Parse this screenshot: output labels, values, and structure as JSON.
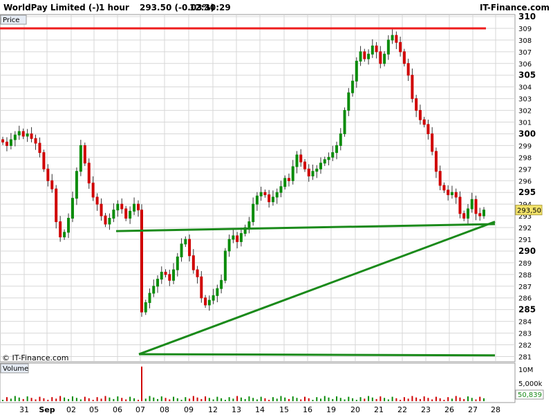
{
  "header": {
    "instrument": "WorldPay Limited (-)",
    "interval": "1 hour",
    "quote": "293.50 (-0.03%)",
    "time": "12:30:29",
    "brand": "IT-Finance.com"
  },
  "price_panel": {
    "label": "Price",
    "watermark": "© IT-Finance.com",
    "last_price_tag": "293,50"
  },
  "volume_panel": {
    "label": "Volume",
    "last_volume_tag": "50,839",
    "y_tick_labels": [
      "10M",
      "5,000k"
    ]
  },
  "colors": {
    "up": "#0a8c0a",
    "down": "#d00000",
    "resistance": "#ee1c1c",
    "support": "#1a8a1a",
    "last_tag_bg": "#f3e36a",
    "grid": "#d7d7d7"
  },
  "chart_data": [
    {
      "type": "candlestick",
      "title": "WorldPay Limited (-)",
      "interval": "1 hour",
      "x_tick_labels": [
        "31",
        "Sep",
        "02",
        "05",
        "06",
        "07",
        "08",
        "09",
        "12",
        "13",
        "14",
        "15",
        "16",
        "19",
        "20",
        "21",
        "22",
        "23",
        "26",
        "27",
        "28"
      ],
      "y_range": [
        280.5,
        310
      ],
      "y_ticks": [
        281,
        282,
        283,
        284,
        285,
        286,
        287,
        288,
        289,
        290,
        291,
        292,
        293,
        294,
        295,
        296,
        297,
        298,
        299,
        300,
        301,
        302,
        303,
        304,
        305,
        306,
        307,
        308,
        309,
        310
      ],
      "y_tick_labels": [
        "281",
        "282",
        "283",
        "284",
        "285",
        "286",
        "287",
        "288",
        "289",
        "290",
        "291",
        "292",
        "293",
        "294",
        "295",
        "296",
        "297",
        "298",
        "299",
        "300",
        "301",
        "302",
        "303",
        "304",
        "305",
        "306",
        "307",
        "308",
        "309",
        "310"
      ],
      "last_price": 293.5,
      "close_series": [
        299.3,
        299.0,
        299.5,
        299.9,
        300.2,
        299.8,
        300.0,
        299.6,
        299.2,
        298.4,
        297.0,
        296.0,
        295.3,
        292.5,
        291.2,
        291.6,
        292.8,
        294.5,
        296.8,
        299.0,
        297.5,
        295.8,
        294.6,
        294.0,
        293.0,
        292.3,
        292.8,
        293.5,
        294.0,
        293.6,
        292.8,
        293.4,
        294.0,
        293.5,
        284.8,
        285.6,
        286.4,
        287.0,
        287.6,
        288.2,
        288.0,
        287.5,
        288.4,
        289.5,
        290.6,
        291.0,
        289.6,
        288.4,
        287.8,
        286.0,
        285.4,
        285.8,
        286.2,
        286.8,
        287.5,
        290.0,
        291.0,
        291.3,
        290.8,
        291.5,
        292.0,
        292.5,
        294.0,
        294.7,
        295.0,
        294.8,
        294.2,
        294.6,
        295.0,
        295.5,
        296.2,
        296.0,
        297.2,
        298.2,
        297.6,
        297.0,
        296.4,
        296.8,
        297.0,
        297.5,
        297.8,
        298.0,
        298.4,
        299.0,
        300.0,
        302.0,
        303.5,
        304.5,
        306.2,
        307.0,
        306.4,
        306.8,
        307.5,
        307.0,
        306.0,
        306.8,
        308.0,
        308.4,
        307.8,
        307.0,
        306.0,
        305.0,
        303.0,
        302.0,
        301.2,
        300.8,
        300.0,
        298.5,
        296.8,
        295.6,
        295.2,
        294.8,
        295.0,
        294.6,
        293.2,
        292.8,
        293.6,
        294.4,
        293.2,
        293.0,
        293.5
      ],
      "support_resistance_lines": [
        {
          "name": "resistance",
          "from": [
            "Aug 31",
            309.0
          ],
          "to": [
            "Sep 27",
            309.0
          ]
        },
        {
          "name": "support",
          "from": [
            "Sep 06",
            291.7
          ],
          "to": [
            "Sep 28",
            292.3
          ]
        },
        {
          "name": "trendline",
          "from": [
            "Sep 07",
            281.2
          ],
          "to": [
            "Sep 28",
            292.5
          ]
        },
        {
          "name": "floor",
          "from": [
            "Sep 07",
            281.2
          ],
          "to": [
            "Sep 28",
            281.1
          ]
        }
      ]
    },
    {
      "type": "bar",
      "title": "Volume",
      "y_tick_labels": [
        "10M",
        "5,000k"
      ],
      "last_value": 50839,
      "spike_at": "Sep 07",
      "spike_value": 10000000
    }
  ]
}
